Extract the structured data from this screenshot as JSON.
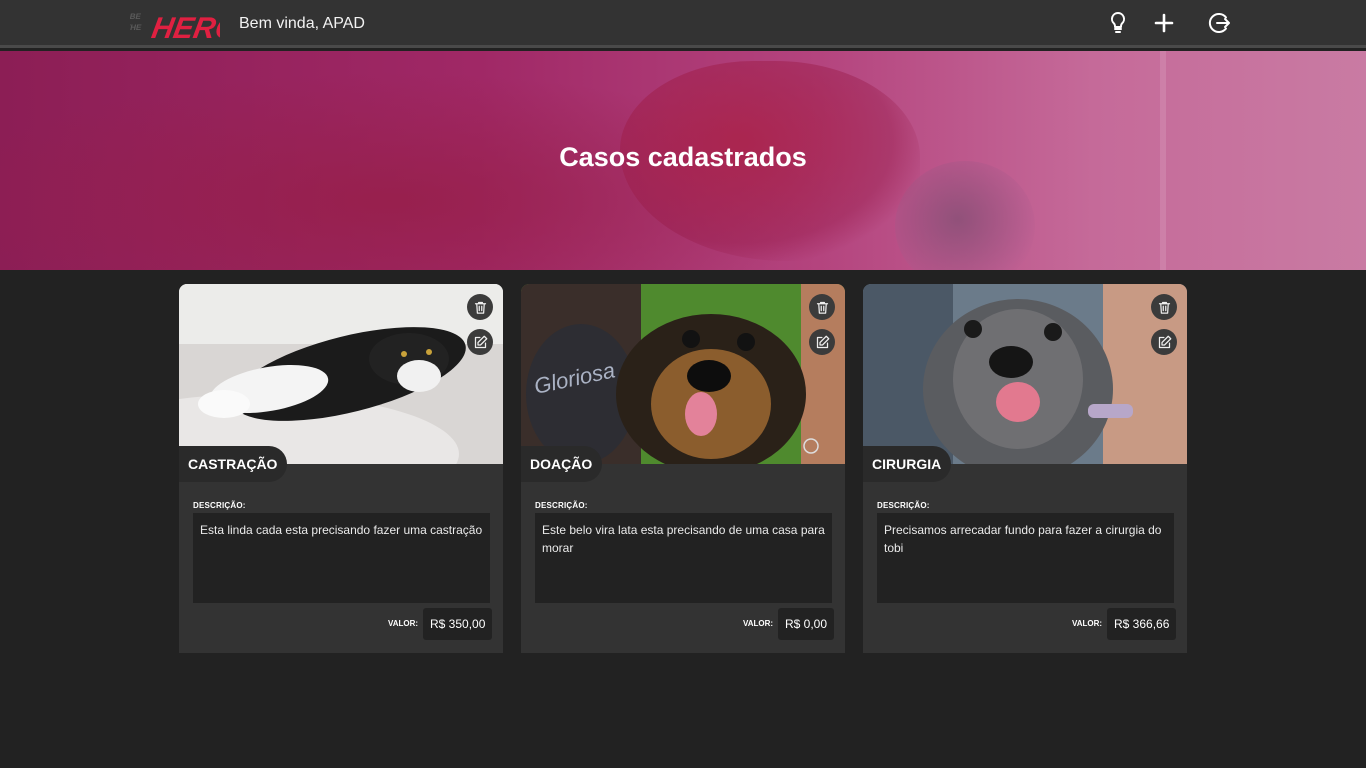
{
  "header": {
    "logo_text_small": "BE THE",
    "logo_text": "HERO",
    "welcome": "Bem vinda, APAD",
    "icons": [
      "lightbulb-icon",
      "plus-icon",
      "logout-icon"
    ]
  },
  "hero": {
    "title": "Casos cadastrados"
  },
  "cases": [
    {
      "tag": "CASTRAÇÃO",
      "description_label": "DESCRIÇÃO:",
      "description": "Esta linda cada esta precisando fazer uma castração",
      "value_label": "VALOR:",
      "value": "R$ 350,00"
    },
    {
      "tag": "DOAÇÃO",
      "description_label": "DESCRIÇÃO:",
      "description": "Este belo vira lata esta precisando de uma casa para morar",
      "value_label": "VALOR:",
      "value": "R$ 0,00"
    },
    {
      "tag": "CIRURGIA",
      "description_label": "DESCRIÇÃO:",
      "description": "Precisamos arrecadar fundo para fazer a cirurgia do tobi",
      "value_label": "VALOR:",
      "value": "R$ 366,66"
    }
  ],
  "colors": {
    "accent": "#e02041",
    "background": "#222222",
    "card": "#333333",
    "hero_overlay": "#a02866"
  }
}
